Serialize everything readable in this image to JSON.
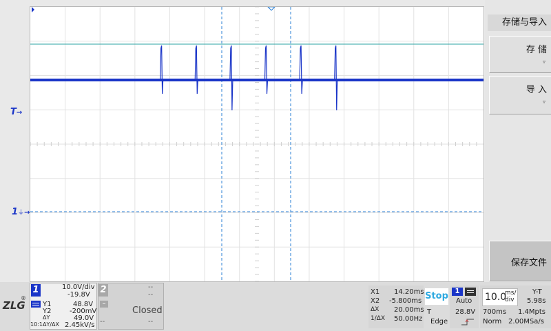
{
  "menu": {
    "title": "存储与导入",
    "save_label": "存 储",
    "import_label": "导 入",
    "save_file_label": "保存文件",
    "dropdown_arrow": "▿"
  },
  "markers": {
    "trigger_label": "T",
    "ch1_label": "1",
    "ground_symbol": "⏚"
  },
  "logo": {
    "text": "ZLG",
    "reg": "®"
  },
  "ch1": {
    "num": "1",
    "scale": "10.0V/div",
    "offset": "-19.8V",
    "coupling_icon": "dc-coupling-icon",
    "y1_label": "Y1",
    "y1_value": "48.8V",
    "y2_label": "Y2",
    "y2_value": "-200mV",
    "dy_label": "ΔY",
    "dy_value": "49.0V",
    "dydx_prefix": "10:1",
    "dydx_label": "ΔY/ΔX",
    "dydx_value": "2.45kV/s"
  },
  "ch2": {
    "num": "2",
    "dash1": "--",
    "dash2": "--",
    "minus": "–",
    "status": "Closed",
    "dash3": "--",
    "dash4": "--"
  },
  "cursors": {
    "x1_label": "X1",
    "x1_value": "14.20ms",
    "x2_label": "X2",
    "x2_value": "-5.800ms",
    "dx_label": "ΔX",
    "dx_value": "20.00ms",
    "inv_label": "1/ΔX",
    "inv_value": "50.00Hz"
  },
  "run": {
    "state": "Stop"
  },
  "trigger": {
    "source": "1",
    "mode": "Auto",
    "t_label": "T",
    "level": "28.8V",
    "type": "Edge",
    "slope_icon": "rising-edge-icon"
  },
  "timebase": {
    "value": "10.0",
    "unit_top": "ms/",
    "unit_bottom": "div",
    "mode": "Y-T",
    "position": "5.98s",
    "window": "700ms",
    "points": "1.4Mpts",
    "acq_mode": "Norm",
    "sample_rate": "2.00MSa/s"
  },
  "colors": {
    "ch1": "#1a35c8",
    "cursor": "#2a7fd4",
    "ref_line": "#2aa3a3",
    "grid": "#dcdcdc"
  },
  "waveform": {
    "pulse_times_ms": [
      -22,
      -12,
      -2,
      8,
      18,
      28
    ],
    "baseline_V": 0
  }
}
